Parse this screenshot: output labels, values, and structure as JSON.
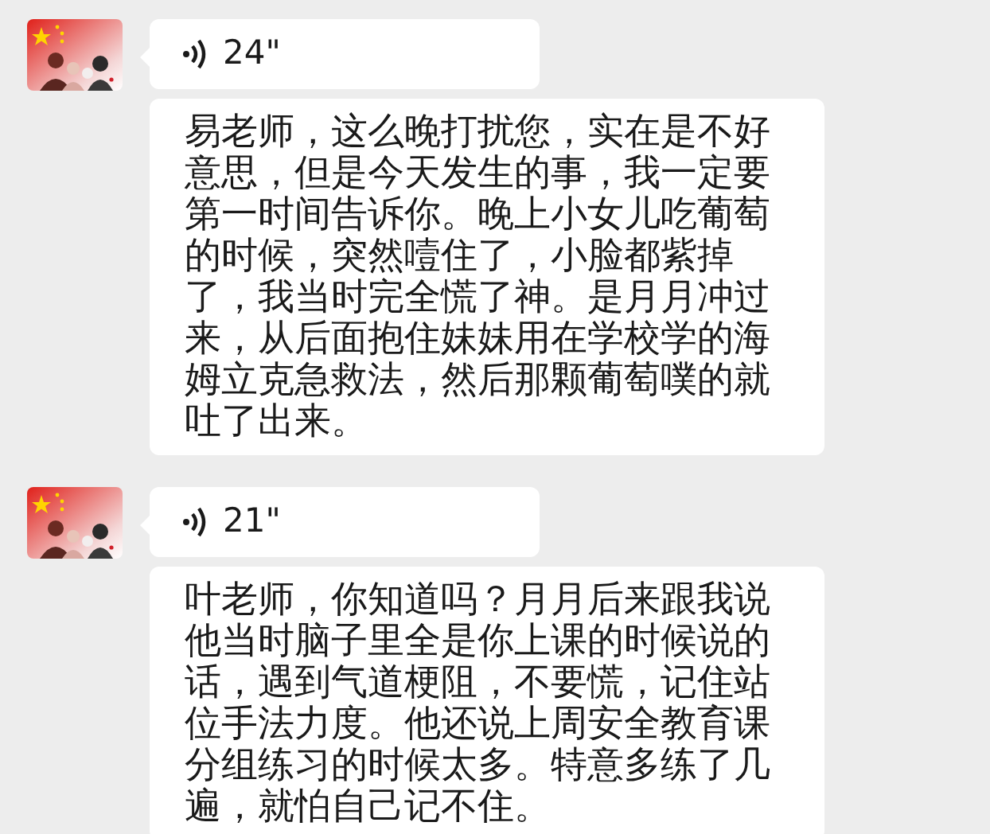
{
  "messages": [
    {
      "voice_duration": "24\"",
      "text": "易老师，这么晚打扰您，实在是不好意思，但是今天发生的事，我一定要第一时间告诉你。晚上小女儿吃葡萄的时候，突然噎住了，小脸都紫掉了，我当时完全慌了神。是月月冲过来，从后面抱住妹妹用在学校学的海姆立克急救法，然后那颗葡萄噗的就吐了出来。"
    },
    {
      "voice_duration": "21\"",
      "text": "叶老师，你知道吗？月月后来跟我说他当时脑子里全是你上课的时候说的话，遇到气道梗阻，不要慌，记住站位手法力度。他还说上周安全教育课分组练习的时候太多。特意多练了几遍，就怕自己记不住。"
    }
  ]
}
